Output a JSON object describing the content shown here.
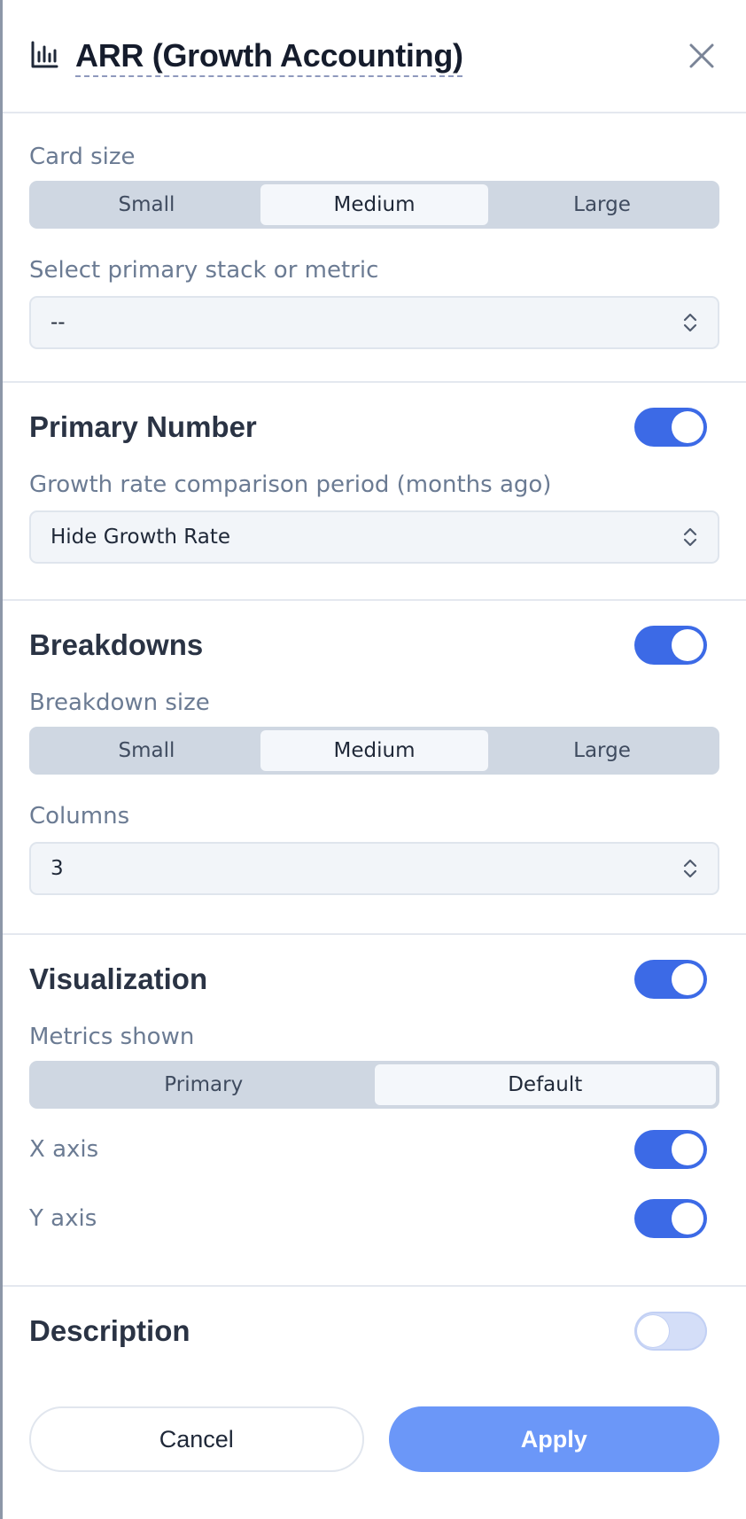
{
  "header": {
    "title": "ARR (Growth Accounting)",
    "icon": "bar-chart-icon",
    "close_icon": "close-icon"
  },
  "card_size": {
    "label": "Card size",
    "options": [
      "Small",
      "Medium",
      "Large"
    ],
    "selected": "Medium"
  },
  "primary_stack": {
    "label": "Select primary stack or metric",
    "value": "--"
  },
  "primary_number": {
    "title": "Primary Number",
    "enabled": true,
    "growth_label": "Growth rate comparison period (months ago)",
    "growth_value": "Hide Growth Rate"
  },
  "breakdowns": {
    "title": "Breakdowns",
    "enabled": true,
    "size_label": "Breakdown size",
    "size_options": [
      "Small",
      "Medium",
      "Large"
    ],
    "size_selected": "Medium",
    "columns_label": "Columns",
    "columns_value": "3"
  },
  "visualization": {
    "title": "Visualization",
    "enabled": true,
    "metrics_label": "Metrics shown",
    "metrics_options": [
      "Primary",
      "Default"
    ],
    "metrics_selected": "Default",
    "x_axis_label": "X axis",
    "x_axis_enabled": true,
    "y_axis_label": "Y axis",
    "y_axis_enabled": true
  },
  "description": {
    "title": "Description",
    "enabled": false
  },
  "footer": {
    "cancel_label": "Cancel",
    "apply_label": "Apply"
  },
  "colors": {
    "accent": "#3c6ae6",
    "apply_button": "#6b97f8",
    "segment_bg": "#cfd7e2"
  }
}
